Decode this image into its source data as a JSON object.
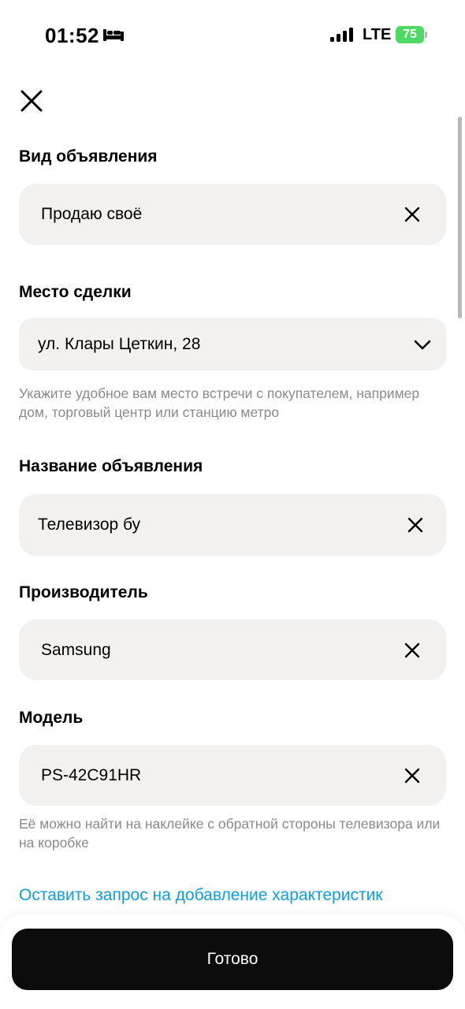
{
  "status_bar": {
    "time": "01:52",
    "network": "LTE",
    "battery": "75",
    "sleep_icon": "bed-icon",
    "signal_icon": "cellular-signal-icon"
  },
  "header": {
    "close_icon": "close-icon"
  },
  "form": {
    "ad_type": {
      "label": "Вид объявления",
      "value": "Продаю своё"
    },
    "deal_place": {
      "label": "Место сделки",
      "value": "ул. Клары Цеткин, 28",
      "hint": "Укажите удобное вам место встречи с покупателем, например дом, торговый центр или станцию метро"
    },
    "title": {
      "label": "Название объявления",
      "value": "Телевизор бу"
    },
    "manufacturer": {
      "label": "Производитель",
      "value": "Samsung"
    },
    "model": {
      "label": "Модель",
      "value": "PS-42C91HR",
      "hint": "Её можно найти на наклейке с обратной стороны телевизора или на коробке"
    },
    "request_link": "Оставить запрос на добавление характеристик"
  },
  "footer": {
    "done_label": "Готово"
  },
  "colors": {
    "field_bg": "#f2f1ef",
    "link": "#0e9ee0",
    "button_bg": "#0c0c0c",
    "hint": "#8a8a8a",
    "battery": "#4cd964"
  }
}
